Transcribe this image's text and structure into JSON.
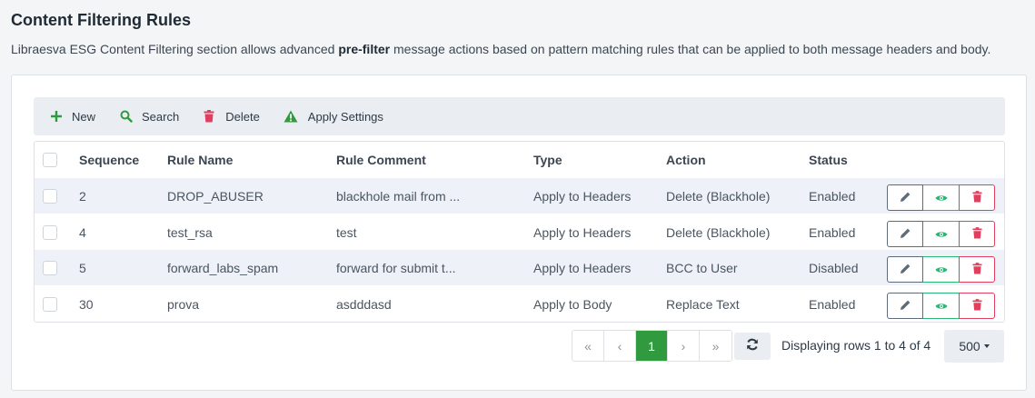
{
  "page": {
    "title": "Content Filtering Rules",
    "desc_before": "Libraesva ESG Content Filtering section allows advanced ",
    "desc_bold": "pre-filter",
    "desc_after": " message actions based on pattern matching rules that can be applied to both message headers and body."
  },
  "toolbar": {
    "new_label": "New",
    "search_label": "Search",
    "delete_label": "Delete",
    "apply_label": "Apply Settings"
  },
  "colors": {
    "new_icon": "#2f9a3e",
    "search_icon": "#2f9a3e",
    "delete_icon": "#e0405e",
    "apply_icon": "#2f9a3e",
    "edit": "#5e6b78",
    "view": "#2bb673",
    "del": "#e0405e",
    "page_active": "#2f9a3e"
  },
  "table": {
    "headers": {
      "sequence": "Sequence",
      "rule_name": "Rule Name",
      "rule_comment": "Rule Comment",
      "type": "Type",
      "action": "Action",
      "status": "Status"
    },
    "rows": [
      {
        "sequence": "2",
        "rule_name": "DROP_ABUSER",
        "rule_comment": "blackhole mail from ...",
        "type": "Apply to Headers",
        "action": "Delete (Blackhole)",
        "status": "Enabled"
      },
      {
        "sequence": "4",
        "rule_name": "test_rsa",
        "rule_comment": "test",
        "type": "Apply to Headers",
        "action": "Delete (Blackhole)",
        "status": "Enabled"
      },
      {
        "sequence": "5",
        "rule_name": "forward_labs_spam",
        "rule_comment": "forward for submit t...",
        "type": "Apply to Headers",
        "action": "BCC to User",
        "status": "Disabled"
      },
      {
        "sequence": "30",
        "rule_name": "prova",
        "rule_comment": "asdddasd",
        "type": "Apply to Body",
        "action": "Replace Text",
        "status": "Enabled"
      }
    ]
  },
  "pagination": {
    "first": "«",
    "prev": "‹",
    "current": "1",
    "next": "›",
    "last": "»",
    "info": "Displaying rows 1 to 4 of 4",
    "page_size": "500"
  }
}
